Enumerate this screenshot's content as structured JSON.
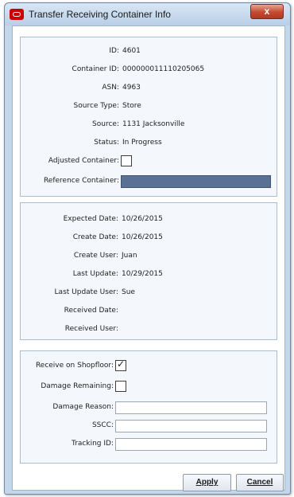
{
  "window": {
    "title": "Transfer Receiving Container Info",
    "close_glyph": "x"
  },
  "container": {
    "id_label": "ID:",
    "id_value": "4601",
    "container_id_label": "Container ID:",
    "container_id_value": "000000011110205065",
    "asn_label": "ASN:",
    "asn_value": "4963",
    "source_type_label": "Source Type:",
    "source_type_value": "Store",
    "source_label": "Source:",
    "source_value": "1131 Jacksonville",
    "status_label": "Status:",
    "status_value": "In Progress",
    "adjusted_label": "Adjusted Container:",
    "adjusted_checked": false,
    "reference_label": "Reference Container:",
    "reference_value": ""
  },
  "dates": {
    "expected_label": "Expected Date:",
    "expected_value": "10/26/2015",
    "create_date_label": "Create Date:",
    "create_date_value": "10/26/2015",
    "create_user_label": "Create User:",
    "create_user_value": "Juan",
    "last_update_label": "Last Update:",
    "last_update_value": "10/29/2015",
    "last_update_user_label": "Last Update User:",
    "last_update_user_value": "Sue",
    "received_date_label": "Received Date:",
    "received_date_value": "",
    "received_user_label": "Received User:",
    "received_user_value": ""
  },
  "receive": {
    "shopfloor_label": "Receive on Shopfloor:",
    "shopfloor_checked": true,
    "check_glyph": "✓",
    "damage_remaining_label": "Damage Remaining:",
    "damage_remaining_checked": false,
    "damage_reason_label": "Damage Reason:",
    "damage_reason_value": "",
    "sscc_label": "SSCC:",
    "sscc_value": "",
    "tracking_label": "Tracking ID:",
    "tracking_value": ""
  },
  "buttons": {
    "apply_label": "Apply",
    "cancel_label": "Cancel"
  },
  "colors": {
    "window_frame": "#c3d6ea",
    "close_button": "#c24a2f",
    "selected_field": "#5a7094",
    "section_background": "#f4f7fb"
  }
}
